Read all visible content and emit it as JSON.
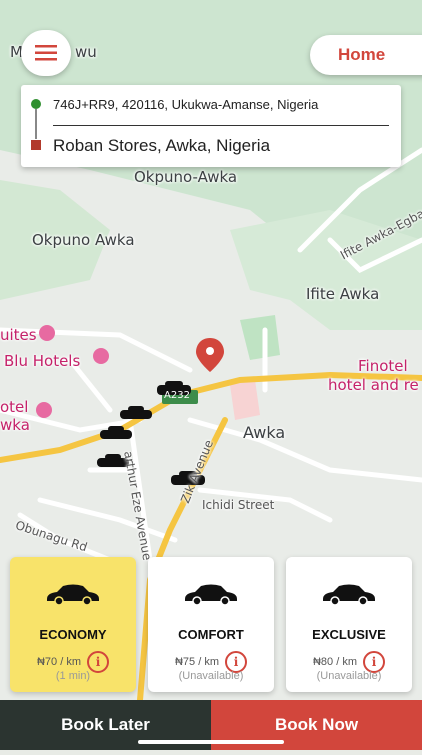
{
  "map": {
    "labels": {
      "top_left": "M",
      "top_left2": "wu",
      "okpuno_awka_top": "Okpuno-Awka",
      "okpuno_awka": "Okpuno Awka",
      "ifite_awka": "Ifite Awka",
      "ifite_road": "Ifite Awka-Egbad",
      "suites": "uites",
      "blu_hotels": "Blu Hotels",
      "finotel": "Finotel",
      "finotel_sub": "hotel and re",
      "hotel_awka_1": "otel",
      "hotel_awka_2": "wka",
      "awka": "Awka",
      "road_a232": "A232",
      "zik_avenue": "Zik Avenue",
      "arthur_eze": "arthur Eze Avenue",
      "ichidi_street": "Ichidi Street",
      "obunagu_rd": "Obunagu Rd"
    }
  },
  "header": {
    "menu_icon": "hamburger-icon",
    "home_label": "Home"
  },
  "route": {
    "from": "746J+RR9, 420116, Ukukwa-Amanse, Nigeria",
    "to": "Roban Stores, Awka, Nigeria"
  },
  "ride_options": [
    {
      "name": "ECONOMY",
      "price": "₦70 / km",
      "status": "(1 min)",
      "selected": true
    },
    {
      "name": "COMFORT",
      "price": "₦75 / km",
      "status": "(Unavailable)",
      "selected": false
    },
    {
      "name": "EXCLUSIVE",
      "price": "₦80 / km",
      "status": "(Unavailable)",
      "selected": false
    }
  ],
  "actions": {
    "book_later": "Book Later",
    "book_now": "Book Now"
  },
  "colors": {
    "accent": "#d2463c",
    "selected_card": "#f8e36a",
    "dark_button": "#2b3430",
    "road": "#f5c542"
  }
}
